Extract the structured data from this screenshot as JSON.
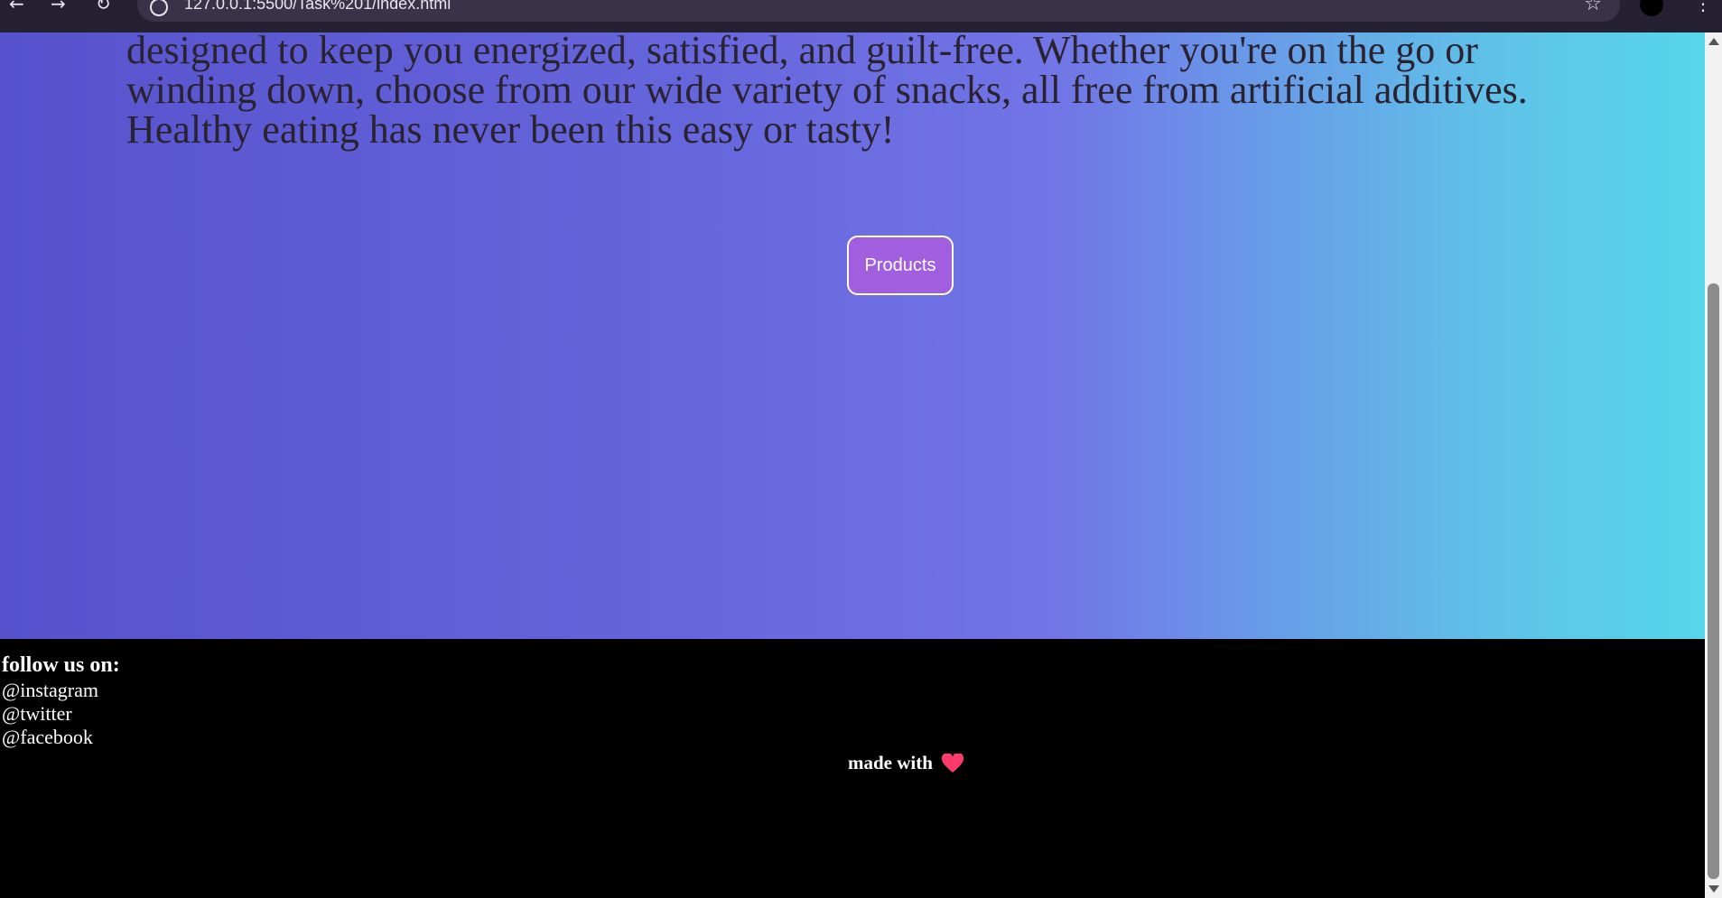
{
  "browser": {
    "url": "127.0.0.1:5500/Task%201/index.html"
  },
  "hero": {
    "intro_line_1": "designed to keep you energized, satisfied, and guilt-free. Whether you're on the go or",
    "intro_line_2": "winding down, choose from our wide variety of snacks, all free from artificial additives.",
    "intro_line_3": "Healthy eating has never been this easy or tasty!",
    "products_button_label": "Products"
  },
  "footer": {
    "follow_title": "follow us on:",
    "social_links": [
      "@instagram",
      "@twitter",
      "@facebook"
    ],
    "made_with_label": "made with",
    "heart_color": "#ff3b6b"
  }
}
